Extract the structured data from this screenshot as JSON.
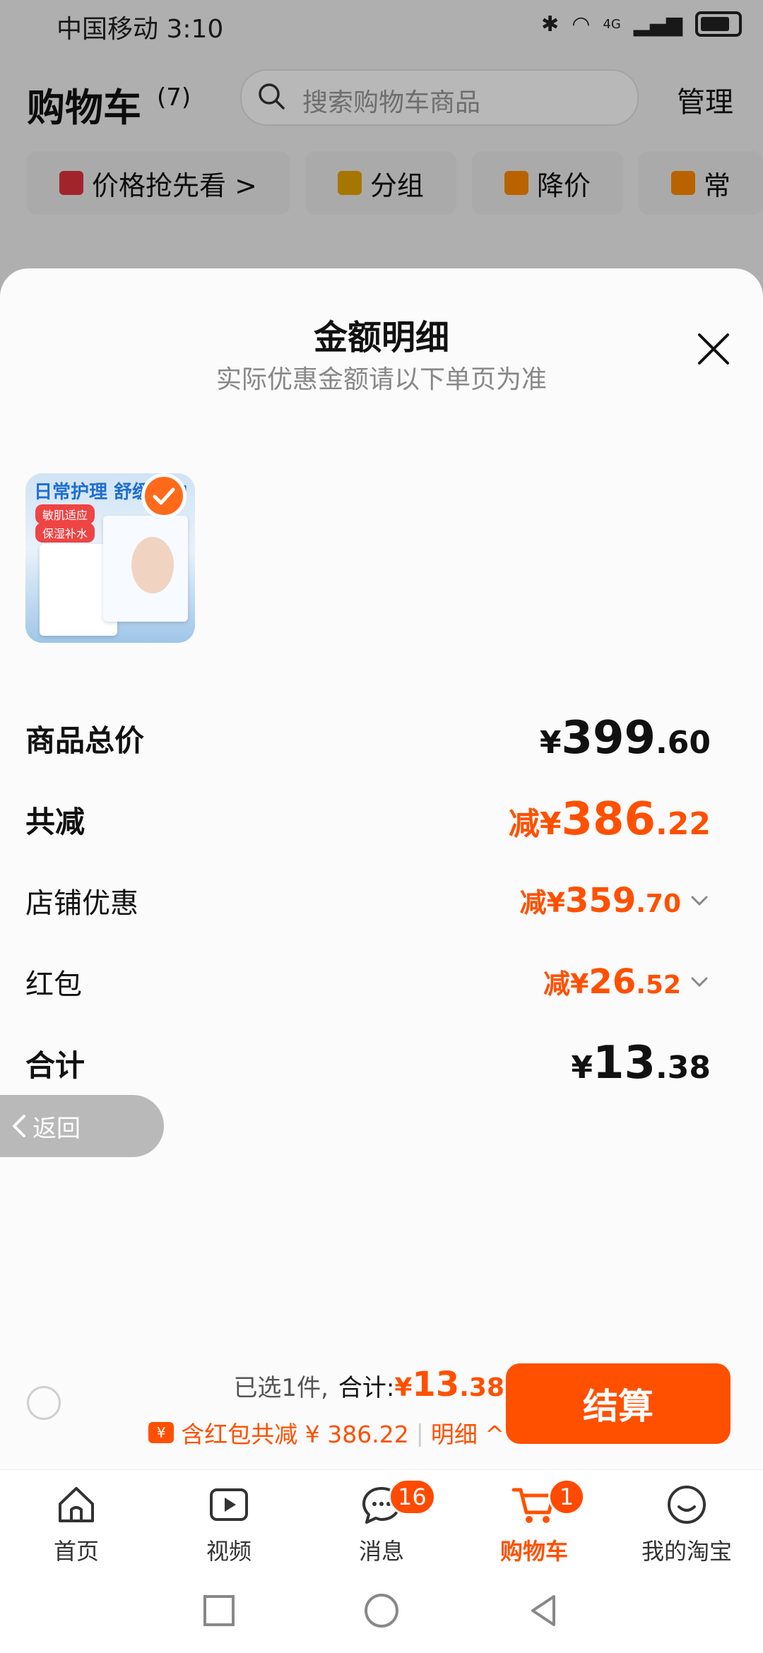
{
  "status_bar": {
    "carrier_time": "中国移动 3:10",
    "network": "4G"
  },
  "cart_header": {
    "title": "购物车",
    "count": "(7)",
    "search_placeholder": "搜索购物车商品",
    "manage": "管理"
  },
  "chips": [
    {
      "label": "价格抢先看 >",
      "icon": "price-tag-icon"
    },
    {
      "label": "分组",
      "icon": "folder-icon"
    },
    {
      "label": "降价",
      "icon": "price-drop-icon"
    },
    {
      "label": "常",
      "icon": "cart-icon"
    }
  ],
  "sheet": {
    "title": "金额明细",
    "subtitle": "实际优惠金额请以下单页为准",
    "product": {
      "banner": "日常护理 舒缓修护",
      "tag1": "敏肌适应",
      "tag2": "保湿补水"
    },
    "rows": [
      {
        "label": "商品总价",
        "prefix": "",
        "currency": "¥",
        "int": "399",
        "dec": ".60"
      },
      {
        "label": "共减",
        "prefix": "减",
        "currency": "¥",
        "int": "386",
        "dec": ".22"
      },
      {
        "label": "店铺优惠",
        "prefix": "减",
        "currency": "¥",
        "int": "359",
        "dec": ".70"
      },
      {
        "label": "红包",
        "prefix": "减",
        "currency": "¥",
        "int": "26",
        "dec": ".52"
      },
      {
        "label": "合计",
        "prefix": "",
        "currency": "¥",
        "int": "13",
        "dec": ".38"
      }
    ]
  },
  "back_pill": {
    "label": "返回"
  },
  "checkout": {
    "selected": "已选1件,",
    "total_label": "合计:",
    "total_currency": "¥",
    "total_int": "13",
    "total_dec": ".38",
    "discount_text": "含红包共减 ¥ 386.22",
    "detail_link": "明细 ^",
    "redpack_glyph": "¥",
    "button": "结算"
  },
  "tabs": [
    {
      "label": "首页",
      "icon": "home-icon"
    },
    {
      "label": "视频",
      "icon": "video-icon"
    },
    {
      "label": "消息",
      "icon": "message-icon",
      "badge": "16"
    },
    {
      "label": "购物车",
      "icon": "cart-icon",
      "badge": "1",
      "active": true
    },
    {
      "label": "我的淘宝",
      "icon": "profile-icon"
    }
  ],
  "colors": {
    "accent": "#ff5000",
    "overlay": "rgba(0,0,0,0.28)",
    "sheet": "#fbfbfb"
  }
}
